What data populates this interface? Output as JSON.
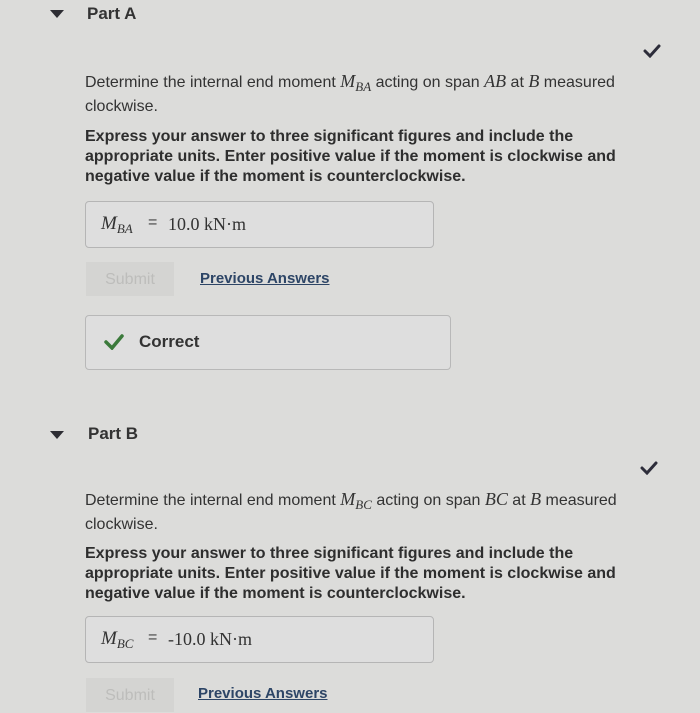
{
  "parts": [
    {
      "title": "Part A",
      "question_prefix": "Determine the internal end moment ",
      "moment_symbol": "M",
      "moment_sub": "BA",
      "question_mid1": " acting on span ",
      "span": "AB",
      "question_mid2": " at ",
      "point": "B",
      "question_suffix": " measured clockwise.",
      "instructions": "Express your answer to three significant figures and include the appropriate units. Enter positive value if the moment is clockwise and negative value if the moment is counterclockwise.",
      "answer_label": "M",
      "answer_sub": "BA",
      "equals": "=",
      "answer_value": "10.0 kN·m",
      "submit_label": "Submit",
      "previous_answers_label": "Previous Answers",
      "feedback": "Correct",
      "status": "correct"
    },
    {
      "title": "Part B",
      "question_prefix": "Determine the internal end moment ",
      "moment_symbol": "M",
      "moment_sub": "BC",
      "question_mid1": " acting on span ",
      "span": "BC",
      "question_mid2": " at ",
      "point": "B",
      "question_suffix": " measured clockwise.",
      "instructions": "Express your answer to three significant figures and include the appropriate units. Enter positive value if the moment is clockwise and negative value if the moment is counterclockwise.",
      "answer_label": "M",
      "answer_sub": "BC",
      "equals": "=",
      "answer_value": "-10.0 kN·m",
      "submit_label": "Submit",
      "previous_answers_label": "Previous Answers",
      "status": "correct"
    }
  ],
  "colors": {
    "check_dark": "#2d2d3a",
    "check_green": "#3b7a3b",
    "link": "#2d4566"
  }
}
